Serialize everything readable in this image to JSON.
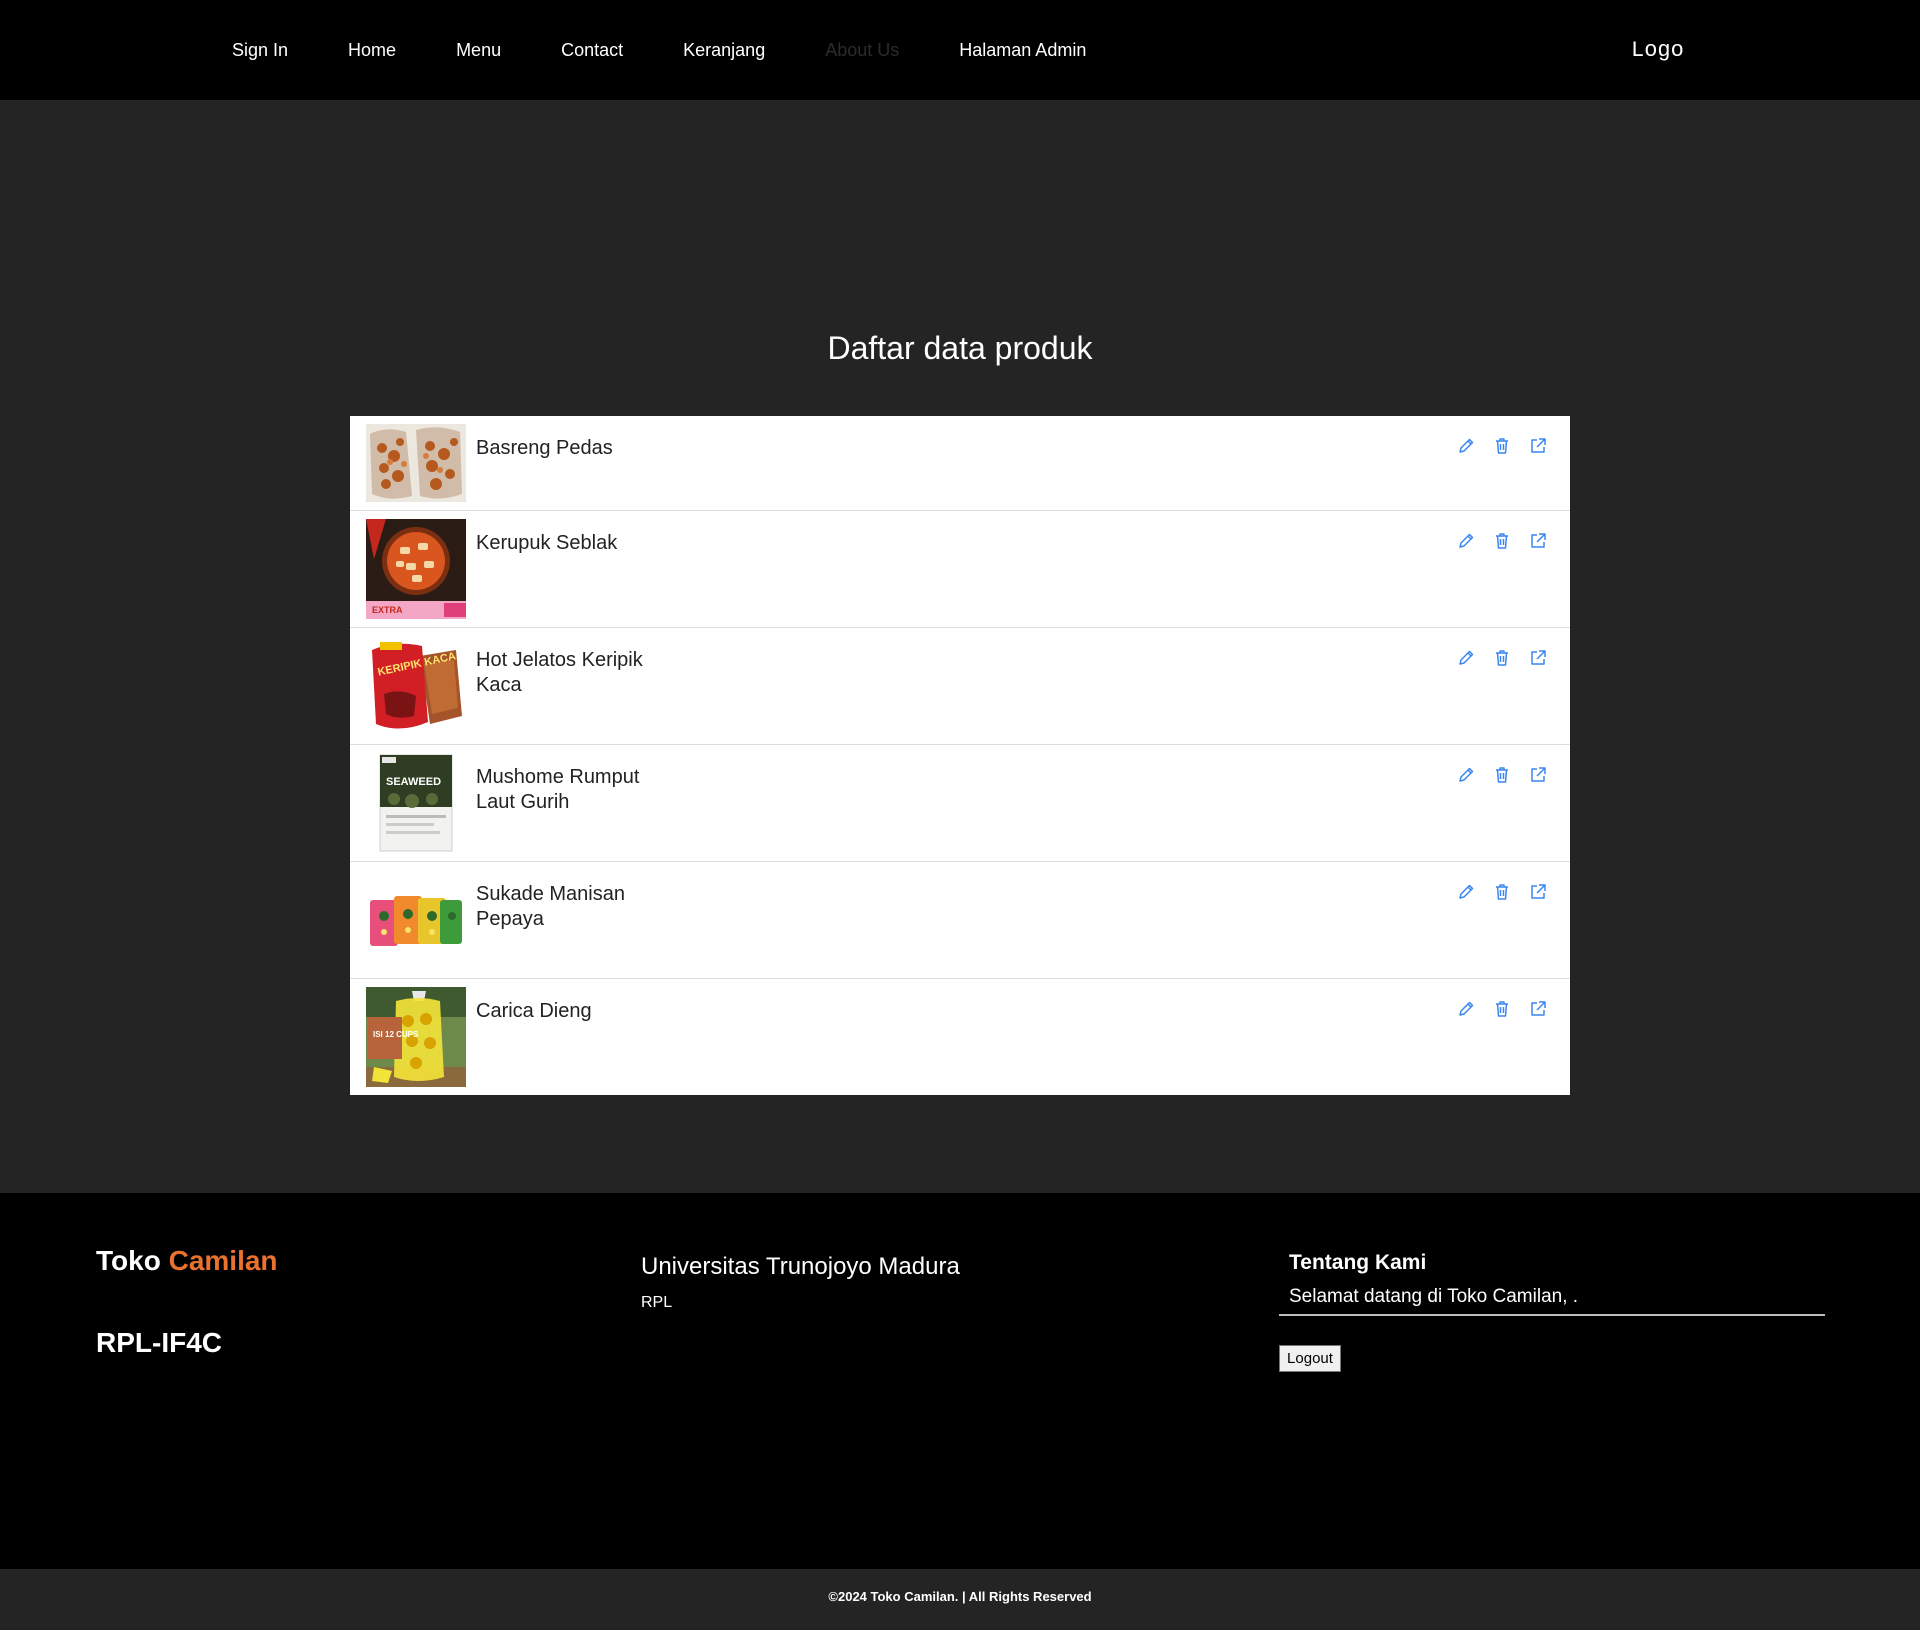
{
  "nav": {
    "links": [
      "Sign In",
      "Home",
      "Menu",
      "Contact",
      "Keranjang",
      "About Us",
      "Halaman Admin"
    ],
    "logo": "Logo"
  },
  "main": {
    "title": "Daftar data produk",
    "products": [
      {
        "name": "Basreng Pedas",
        "image": "basreng-bags"
      },
      {
        "name": "Kerupuk Seblak",
        "image": "seblak-bowl"
      },
      {
        "name": "Hot Jelatos Keripik Kaca",
        "image": "keripik-kaca-bag"
      },
      {
        "name": "Mushome Rumput Laut Gurih",
        "image": "seaweed-box"
      },
      {
        "name": "Sukade Manisan Pepaya",
        "image": "sukade-packs"
      },
      {
        "name": "Carica Dieng",
        "image": "carica-cups"
      }
    ],
    "thumb_texts": {
      "seblak": "EXTRA",
      "keripik": "KERIPIK KACA",
      "seaweed": "SEAWEED",
      "carica": "ISI 12 CUPS"
    },
    "actions": [
      "edit-icon",
      "trash-icon",
      "external-link-icon"
    ]
  },
  "footer": {
    "brand_first": "Toko",
    "brand_second": "Camilan",
    "class_code": "RPL-IF4C",
    "university": "Universitas Trunojoyo Madura",
    "university_sub": "RPL",
    "about_title": "Tentang Kami",
    "welcome": "Selamat datang di Toko Camilan, .",
    "logout": "Logout",
    "copyright": "©2024 Toko Camilan. | All Rights Reserved"
  },
  "colors": {
    "accent": "#e9722e",
    "icon": "#3a86f0",
    "background": "#242424",
    "bar": "#000000"
  }
}
